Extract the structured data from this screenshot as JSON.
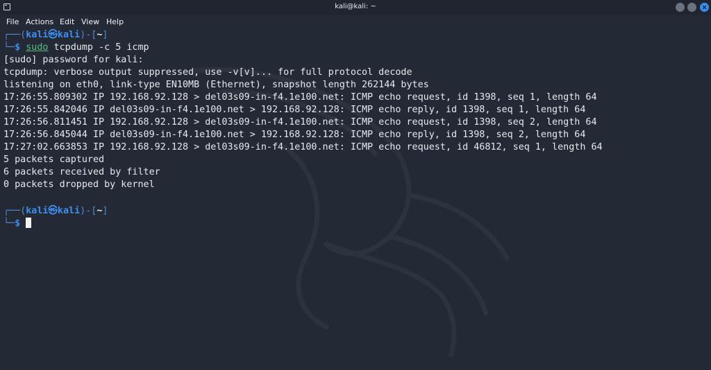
{
  "window": {
    "title": "kali@kali: ~",
    "accent_color": "#3d8cf0",
    "background_color": "#242a35"
  },
  "menu": [
    "File",
    "Actions",
    "Edit",
    "View",
    "Help"
  ],
  "prompt": {
    "open": "┌──(",
    "user": "kali",
    "at": "㉿",
    "host": "kali",
    "mid": ")-[",
    "cwd": "~",
    "close": "]",
    "corner": "└─",
    "dollar": "$"
  },
  "command": {
    "sudo": "sudo",
    "rest": " tcpdump -c 5 icmp"
  },
  "output": [
    "[sudo] password for kali:",
    "tcpdump: verbose output suppressed, use -v[v]... for full protocol decode",
    "listening on eth0, link-type EN10MB (Ethernet), snapshot length 262144 bytes",
    "17:26:55.809302 IP 192.168.92.128 > del03s09-in-f4.1e100.net: ICMP echo request, id 1398, seq 1, length 64",
    "17:26:55.842046 IP del03s09-in-f4.1e100.net > 192.168.92.128: ICMP echo reply, id 1398, seq 1, length 64",
    "17:26:56.811451 IP 192.168.92.128 > del03s09-in-f4.1e100.net: ICMP echo request, id 1398, seq 2, length 64",
    "17:26:56.845044 IP del03s09-in-f4.1e100.net > 192.168.92.128: ICMP echo reply, id 1398, seq 2, length 64",
    "17:27:02.663853 IP 192.168.92.128 > del03s09-in-f4.1e100.net: ICMP echo request, id 46812, seq 1, length 64",
    "5 packets captured",
    "6 packets received by filter",
    "0 packets dropped by kernel"
  ]
}
